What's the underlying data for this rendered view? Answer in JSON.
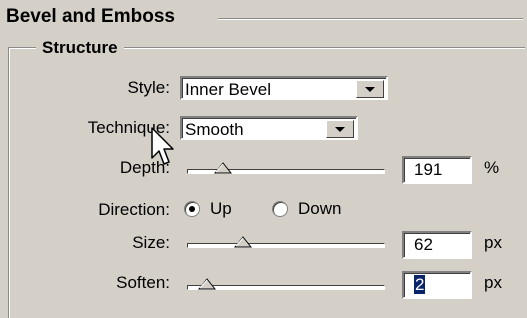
{
  "panel": {
    "title": "Bevel and Emboss",
    "section": "Structure"
  },
  "style_field": {
    "label": "Style:",
    "value": "Inner Bevel"
  },
  "technique_field": {
    "label": "Technique:",
    "value": "Smooth"
  },
  "depth_field": {
    "label": "Depth:",
    "value": "191",
    "unit": "%",
    "slider_fraction": 0.18
  },
  "direction_field": {
    "label": "Direction:",
    "options": [
      "Up",
      "Down"
    ],
    "selected": "Up"
  },
  "size_field": {
    "label": "Size:",
    "value": "62",
    "unit": "px",
    "slider_fraction": 0.28
  },
  "soften_field": {
    "label": "Soften:",
    "value": "2",
    "unit": "px",
    "slider_fraction": 0.1
  },
  "icons": {
    "cursor": "mouse-pointer-icon"
  }
}
